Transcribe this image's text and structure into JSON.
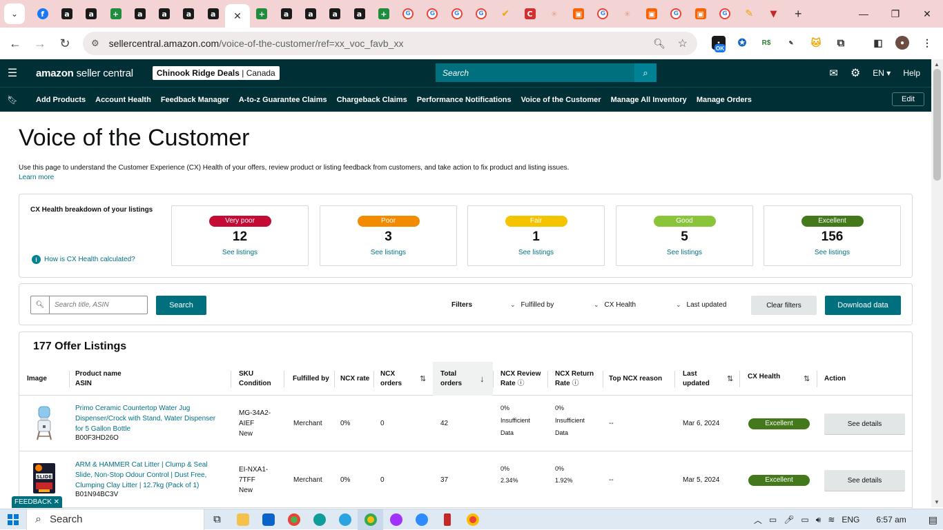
{
  "browser": {
    "url_domain": "sellercentral.amazon.com",
    "url_path": "/voice-of-the-customer/ref=xx_voc_favb_xx",
    "tabs": [
      {
        "icon": "facebook-icon",
        "glyph": "f",
        "cls": "fb"
      },
      {
        "icon": "amazon-icon",
        "glyph": "a",
        "cls": "amz"
      },
      {
        "icon": "amazon-icon",
        "glyph": "a",
        "cls": "amz"
      },
      {
        "icon": "plus-icon",
        "glyph": "+",
        "cls": "plus"
      },
      {
        "icon": "amazon-icon",
        "glyph": "a",
        "cls": "amz"
      },
      {
        "icon": "amazon-icon",
        "glyph": "a",
        "cls": "amz"
      },
      {
        "icon": "amazon-icon",
        "glyph": "a",
        "cls": "amz"
      },
      {
        "icon": "amazon-icon",
        "glyph": "a",
        "cls": "amz"
      },
      {
        "icon": "close-icon",
        "glyph": "✕",
        "cls": "active"
      },
      {
        "icon": "plus-icon",
        "glyph": "+",
        "cls": "plus"
      },
      {
        "icon": "amazon-icon",
        "glyph": "a",
        "cls": "amz"
      },
      {
        "icon": "amazon-icon",
        "glyph": "a",
        "cls": "amz"
      },
      {
        "icon": "amazon-icon",
        "glyph": "a",
        "cls": "amz"
      },
      {
        "icon": "amazon-icon",
        "glyph": "a",
        "cls": "amz"
      },
      {
        "icon": "plus-icon",
        "glyph": "+",
        "cls": "plus"
      },
      {
        "icon": "google-icon",
        "glyph": "G",
        "cls": "g"
      },
      {
        "icon": "google-icon",
        "glyph": "G",
        "cls": "g"
      },
      {
        "icon": "google-icon",
        "glyph": "G",
        "cls": "g"
      },
      {
        "icon": "google-icon",
        "glyph": "G",
        "cls": "g"
      },
      {
        "icon": "v-icon",
        "glyph": "✔",
        "cls": "v"
      },
      {
        "icon": "c-icon",
        "glyph": "C",
        "cls": "red"
      },
      {
        "icon": "dot-icon",
        "glyph": "✳",
        "cls": "dot"
      },
      {
        "icon": "home-depot-icon",
        "glyph": "▣",
        "cls": "orange"
      },
      {
        "icon": "google-icon",
        "glyph": "G",
        "cls": "g"
      },
      {
        "icon": "dot-icon",
        "glyph": "✳",
        "cls": "dot"
      },
      {
        "icon": "home-depot-icon",
        "glyph": "▣",
        "cls": "orange"
      },
      {
        "icon": "google-icon",
        "glyph": "G",
        "cls": "g"
      },
      {
        "icon": "home-depot-icon",
        "glyph": "▣",
        "cls": "orange"
      },
      {
        "icon": "google-icon",
        "glyph": "G",
        "cls": "g"
      },
      {
        "icon": "pencil-icon",
        "glyph": "✎",
        "cls": "v"
      },
      {
        "icon": "triangle-icon",
        "glyph": "▼",
        "cls": "rd"
      }
    ]
  },
  "header": {
    "logo_main": "amazon",
    "logo_sub": " seller central",
    "store_name": "Chinook Ridge Deals",
    "store_sep": " | ",
    "store_market": "Canada",
    "search_placeholder": "Search",
    "language": "EN",
    "help": "Help"
  },
  "nav": {
    "items": [
      "Add Products",
      "Account Health",
      "Feedback Manager",
      "A-to-z Guarantee Claims",
      "Chargeback Claims",
      "Performance Notifications",
      "Voice of the Customer",
      "Manage All Inventory",
      "Manage Orders"
    ],
    "edit": "Edit"
  },
  "page": {
    "title": "Voice of the Customer",
    "description": "Use this page to understand the Customer Experience (CX) Health of your offers, review product or listing feedback from customers, and take action to fix product and listing issues.",
    "learn_more": "Learn more"
  },
  "cx_health": {
    "title": "CX Health breakdown of your listings",
    "how_link": "How is CX Health calculated?",
    "cards": [
      {
        "label": "Very poor",
        "count": "12",
        "link": "See listings",
        "color": "#c40b35"
      },
      {
        "label": "Poor",
        "count": "3",
        "link": "See listings",
        "color": "#f28b00"
      },
      {
        "label": "Fair",
        "count": "1",
        "link": "See listings",
        "color": "#f5c400"
      },
      {
        "label": "Good",
        "count": "5",
        "link": "See listings",
        "color": "#8ac43a"
      },
      {
        "label": "Excellent",
        "count": "156",
        "link": "See listings",
        "color": "#43781b"
      }
    ]
  },
  "filters": {
    "search_placeholder": "Search title, ASIN",
    "search_button": "Search",
    "label": "Filters",
    "fulfilled_by": "Fulfilled by",
    "cx_health": "CX Health",
    "last_updated": "Last updated",
    "clear": "Clear filters",
    "download": "Download data"
  },
  "table": {
    "title": "177 Offer Listings",
    "headers": {
      "image": "Image",
      "product_name": "Product name",
      "asin": "ASIN",
      "sku": "SKU",
      "condition": "Condition",
      "fulfilled_by": "Fulfilled by",
      "ncx_rate": "NCX rate",
      "ncx_orders_1": "NCX",
      "ncx_orders_2": "orders",
      "total_orders_1": "Total",
      "total_orders_2": "orders",
      "review_rate_1": "NCX Review",
      "review_rate_2": "Rate",
      "return_rate_1": "NCX Return",
      "return_rate_2": "Rate",
      "top_reason": "Top NCX reason",
      "last_updated_1": "Last",
      "last_updated_2": "updated",
      "cx_health": "CX Health",
      "action": "Action"
    },
    "rows": [
      {
        "name_1": "Primo Ceramic Countertop Water Jug",
        "name_2": "Dispenser/Crock with Stand, Water Dispenser",
        "name_3": "for 5 Gallon Bottle",
        "asin": "B00F3HD26O",
        "sku_1": "MG-34A2-",
        "sku_2": "AIEF",
        "condition": "New",
        "fulfilled": "Merchant",
        "ncx_rate": "0%",
        "ncx_orders": "0",
        "total_orders": "42",
        "review_1": "0%",
        "review_2": "Insufficient",
        "review_3": "Data",
        "return_1": "0%",
        "return_2": "Insufficient",
        "return_3": "Data",
        "reason": "--",
        "updated": "Mar 6, 2024",
        "health": "Excellent",
        "action": "See details"
      },
      {
        "name_1": "ARM & HAMMER Cat Litter | Clump & Seal",
        "name_2": "Slide, Non-Stop Odour Control | Dust Free,",
        "name_3": "Clumping Clay Litter | 12.7kg (Pack of 1)",
        "asin": "B01N94BC3V",
        "sku_1": "EI-NXA1-",
        "sku_2": "7TFF",
        "condition": "New",
        "fulfilled": "Merchant",
        "ncx_rate": "0%",
        "ncx_orders": "0",
        "total_orders": "37",
        "review_1": "0%",
        "review_2": "2.34%",
        "review_3": "",
        "return_1": "0%",
        "return_2": "1.92%",
        "return_3": "",
        "reason": "--",
        "updated": "Mar 5, 2024",
        "health": "Excellent",
        "action": "See details"
      }
    ]
  },
  "feedback_tab": "FEEDBACK ✕",
  "taskbar": {
    "search": "Search",
    "language": "ENG",
    "time": "6:57 am"
  }
}
